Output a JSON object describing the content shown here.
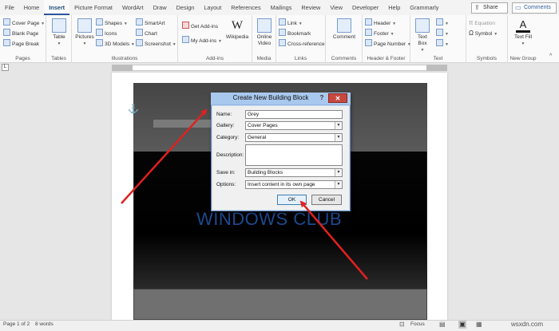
{
  "tabs": [
    "File",
    "Home",
    "Insert",
    "Picture Format",
    "WordArt",
    "Draw",
    "Design",
    "Layout",
    "References",
    "Mailings",
    "Review",
    "View",
    "Developer",
    "Help",
    "Grammarly"
  ],
  "active_tab": "Insert",
  "header_buttons": {
    "share": "Share",
    "comments": "Comments"
  },
  "ribbon": {
    "pages": {
      "items": [
        "Cover Page",
        "Blank Page",
        "Page Break"
      ],
      "label": "Pages"
    },
    "tables": {
      "table": "Table",
      "label": "Tables"
    },
    "illustrations": {
      "pictures": "Pictures",
      "shapes": "Shapes",
      "icons": "Icons",
      "models": "3D Models",
      "smartart": "SmartArt",
      "chart": "Chart",
      "screenshot": "Screenshot",
      "label": "Illustrations"
    },
    "addins": {
      "get": "Get Add-ins",
      "my": "My Add-ins",
      "wikipedia": "Wikipedia",
      "label": "Add-ins"
    },
    "media": {
      "online_video": "Online Video",
      "label": "Media"
    },
    "links": {
      "link": "Link",
      "bookmark": "Bookmark",
      "cross": "Cross-reference",
      "label": "Links"
    },
    "comments": {
      "comment": "Comment",
      "label": "Comments"
    },
    "header_footer": {
      "header": "Header",
      "footer": "Footer",
      "page_number": "Page Number",
      "label": "Header & Footer"
    },
    "text": {
      "text_box": "Text Box",
      "label": "Text"
    },
    "symbols": {
      "equation": "Equation",
      "symbol": "Symbol",
      "label": "Symbols"
    },
    "new_group": {
      "text_fill": "Text Fill",
      "label": "New Group"
    }
  },
  "document": {
    "watermark": "WINDOWS CLUB"
  },
  "dialog": {
    "title": "Create New Building Block",
    "help": "?",
    "close": "✕",
    "fields": {
      "name": {
        "label": "Name:",
        "value": "Grey"
      },
      "gallery": {
        "label": "Gallery:",
        "value": "Cover Pages"
      },
      "category": {
        "label": "Category:",
        "value": "General"
      },
      "description": {
        "label": "Description:",
        "value": ""
      },
      "save_in": {
        "label": "Save in:",
        "value": "Building Blocks"
      },
      "options": {
        "label": "Options:",
        "value": "Insert content in its own page"
      }
    },
    "ok": "OK",
    "cancel": "Cancel"
  },
  "status": {
    "page": "Page 1 of 2",
    "words": "8 words",
    "focus": "Focus",
    "watermark": "wsxdn.com"
  },
  "colors": {
    "accent": "#2b579a",
    "arrow": "#e02020",
    "dialog_title": "#a9c8ee",
    "close": "#c9483d"
  }
}
